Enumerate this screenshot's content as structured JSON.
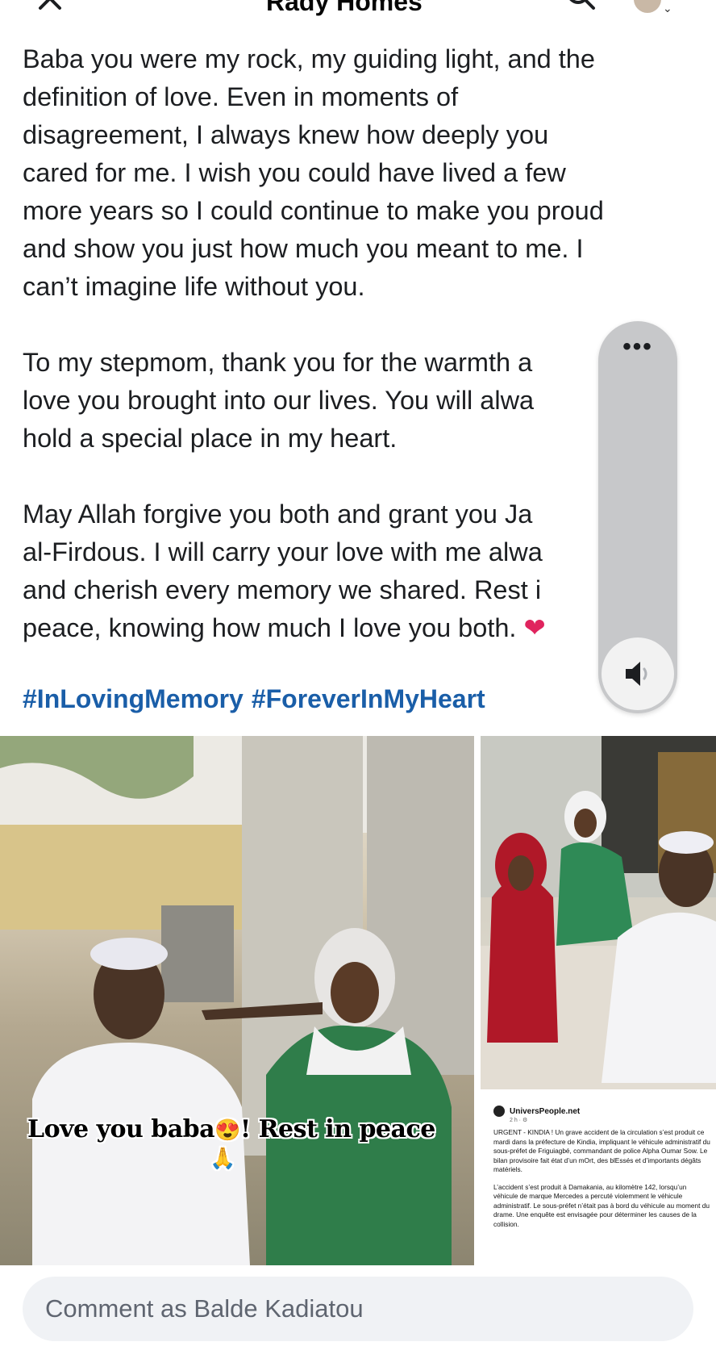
{
  "header": {
    "title": "Rady Homes",
    "close_icon": "close-icon",
    "search_icon": "search-icon"
  },
  "post": {
    "paragraphs": [
      "Baba you were my rock, my guiding light, and the\ndefinition of love. Even in moments of\ndisagreement, I always knew how deeply you\ncared for me. I wish you could have lived a few\nmore years so I could continue to make you proud\nand show you just how much you meant to me. I\ncan’t imagine life without you.",
      "To my stepmom, thank you for the warmth a\nlove you brought into our lives. You will alwa\nhold a special place in my heart.",
      "May Allah forgive you both and grant you Ja\nal-Firdous. I will carry your love with me alwa\nand cherish every memory we shared. Rest i\npeace, knowing how much I love you both."
    ],
    "heart_emoji": "❤",
    "hashtags": [
      "#InLovingMemory",
      "#ForeverInMyHeart"
    ]
  },
  "floating_panel": {
    "more_label": "•••",
    "speaker_icon": "speaker-icon"
  },
  "media": {
    "overlay_caption": "Love you baba",
    "overlay_emoji_1": "😍",
    "overlay_caption_2": "! Rest in peace",
    "overlay_emoji_2": "🙏",
    "article": {
      "source": "UniversPeople.net",
      "date": "2 h · ⚙",
      "paragraph_1": "URGENT - KINDIA ! Un grave accident de la circulation s’est produit ce mardi dans la préfecture de Kindia, impliquant le véhicule administratif du sous-préfet de Friguiagbé, commandant de police Alpha Oumar Sow. Le bilan provisoire fait état d’un mOrt, des blEssés et d’importants dégâts matériels.",
      "paragraph_2": "L’accident s’est produit à Damakania, au kilomètre 142, lorsqu’un véhicule de marque Mercedes a percuté violemment le véhicule administratif. Le sous-préfet n’était pas à bord du véhicule au moment du drame. Une enquête est envisagée pour déterminer les causes de la collision."
    }
  },
  "comment": {
    "placeholder": "Comment as Balde Kadiatou"
  },
  "colors": {
    "hashtag": "#1a5ea8",
    "comment_bg": "#f0f2f5",
    "panel_bg": "#c7c8ca"
  }
}
